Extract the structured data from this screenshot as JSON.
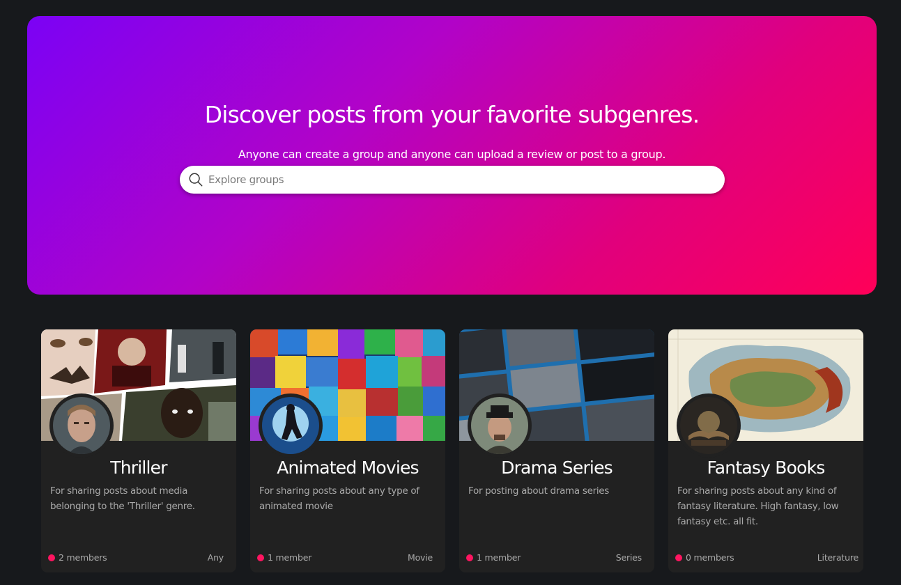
{
  "hero": {
    "title": "Discover posts from your favorite subgenres.",
    "subtitle": "Anyone can create a group and anyone can upload a review or post to a group.",
    "search_placeholder": "Explore groups",
    "gradient": [
      "#7b02f5",
      "#ff0058"
    ]
  },
  "accent_color": "#ff1560",
  "groups": [
    {
      "title": "Thriller",
      "description": "For sharing posts about media belonging to the 'Thriller' genre.",
      "members": "2 members",
      "category": "Any"
    },
    {
      "title": "Animated Movies",
      "description": "For sharing posts about any type of animated movie",
      "members": "1 member",
      "category": "Movie"
    },
    {
      "title": "Drama Series",
      "description": "For posting about drama series",
      "members": "1 member",
      "category": "Series"
    },
    {
      "title": "Fantasy Books",
      "description": "For sharing posts about any kind of fantasy literature. High fantasy, low fantasy etc. all fit.",
      "members": "0 members",
      "category": "Literature"
    }
  ]
}
